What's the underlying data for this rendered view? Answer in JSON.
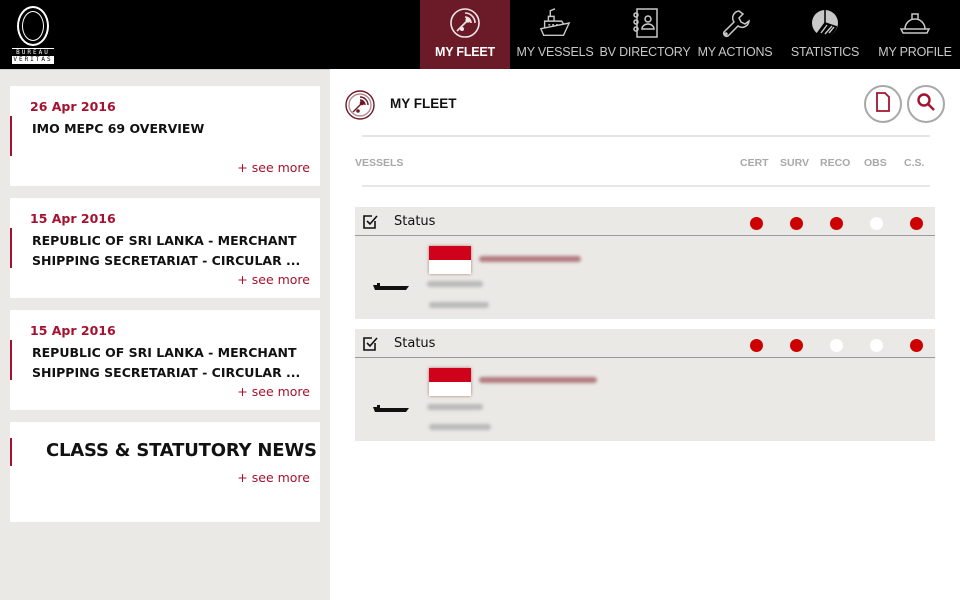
{
  "logo": {
    "line1": "BUREAU",
    "line2": "VERITAS"
  },
  "nav": [
    {
      "label": "MY FLEET",
      "icon": "radar-icon",
      "active": true
    },
    {
      "label": "MY VESSELS",
      "icon": "ship-icon",
      "active": false
    },
    {
      "label": "BV DIRECTORY",
      "icon": "address-book-icon",
      "active": false
    },
    {
      "label": "MY ACTIONS",
      "icon": "wrench-icon",
      "active": false
    },
    {
      "label": "STATISTICS",
      "icon": "pie-chart-icon",
      "active": false
    },
    {
      "label": "MY PROFILE",
      "icon": "hard-hat-icon",
      "active": false
    }
  ],
  "news": [
    {
      "date": "26 Apr 2016",
      "title": "IMO MEPC 69 OVERVIEW",
      "more": "+ see more"
    },
    {
      "date": "15 Apr 2016",
      "title": "REPUBLIC OF SRI LANKA - MERCHANT SHIPPING SECRETARIAT - CIRCULAR ...",
      "more": "+ see more"
    },
    {
      "date": "15 Apr 2016",
      "title": "REPUBLIC OF SRI LANKA - MERCHANT SHIPPING SECRETARIAT - CIRCULAR ...",
      "more": "+ see more"
    }
  ],
  "class_news": {
    "title": "CLASS & STATUTORY NEWS",
    "more": "+ see more"
  },
  "main": {
    "title": "MY FLEET",
    "columns": {
      "vessels": "VESSELS",
      "cert": "CERT",
      "surv": "SURV",
      "reco": "RECO",
      "obs": "OBS",
      "cs": "C.S."
    },
    "vessels": [
      {
        "status_label": "Status",
        "checked": true,
        "flag": "Indonesia/Monaco (red-white)",
        "name": "[redacted]",
        "statuses": {
          "cert": "red",
          "surv": "red",
          "reco": "red",
          "obs": "white",
          "cs": "red"
        }
      },
      {
        "status_label": "Status",
        "checked": true,
        "flag": "Indonesia/Monaco (red-white)",
        "name": "[redacted]",
        "statuses": {
          "cert": "red",
          "surv": "red",
          "reco": "white",
          "obs": "white",
          "cs": "red"
        }
      }
    ]
  },
  "colors": {
    "brand": "#a5122f",
    "nav_active": "#6b1a27",
    "status_red": "#cc0000",
    "status_white": "#ffffff",
    "sidebar_bg": "#ebe9e5"
  }
}
